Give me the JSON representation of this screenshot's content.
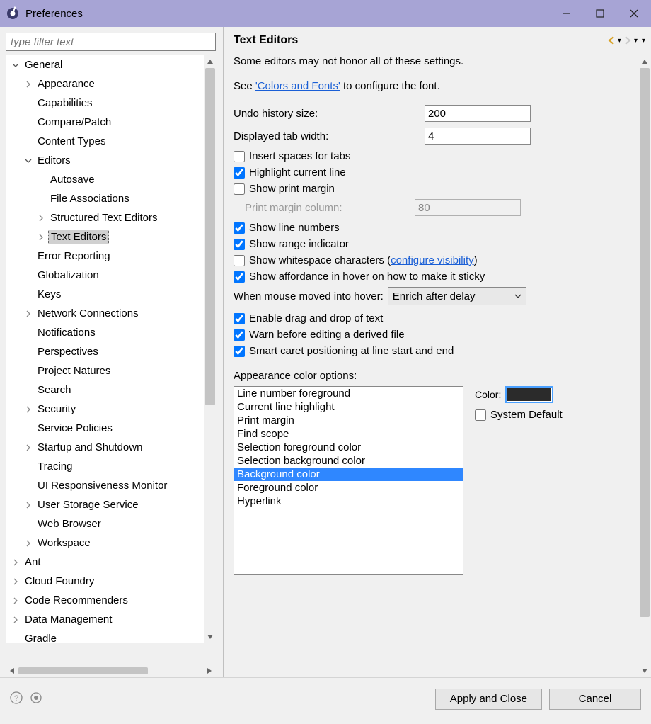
{
  "window": {
    "title": "Preferences"
  },
  "filter": {
    "placeholder": "type filter text"
  },
  "tree": {
    "general": "General",
    "appearance": "Appearance",
    "capabilities": "Capabilities",
    "compare_patch": "Compare/Patch",
    "content_types": "Content Types",
    "editors": "Editors",
    "autosave": "Autosave",
    "file_assoc": "File Associations",
    "structured_te": "Structured Text Editors",
    "text_editors": "Text Editors",
    "error_reporting": "Error Reporting",
    "globalization": "Globalization",
    "keys": "Keys",
    "network": "Network Connections",
    "notifications": "Notifications",
    "perspectives": "Perspectives",
    "project_natures": "Project Natures",
    "search": "Search",
    "security": "Security",
    "service_policies": "Service Policies",
    "startup": "Startup and Shutdown",
    "tracing": "Tracing",
    "ui_resp": "UI Responsiveness Monitor",
    "user_storage": "User Storage Service",
    "web_browser": "Web Browser",
    "workspace": "Workspace",
    "ant": "Ant",
    "cloud_foundry": "Cloud Foundry",
    "code_rec": "Code Recommenders",
    "data_mgmt": "Data Management",
    "gradle": "Gradle"
  },
  "page": {
    "title": "Text Editors",
    "info1": "Some editors may not honor all of these settings.",
    "info2a": "See ",
    "info2link": "'Colors and Fonts'",
    "info2b": " to configure the font.",
    "undo_label": "Undo history size:",
    "undo_value": "200",
    "tabw_label": "Displayed tab width:",
    "tabw_value": "4",
    "cb_insert_spaces": "Insert spaces for tabs",
    "cb_highlight": "Highlight current line",
    "cb_print_margin": "Show print margin",
    "pm_col_label": "Print margin column:",
    "pm_col_value": "80",
    "cb_line_numbers": "Show line numbers",
    "cb_range": "Show range indicator",
    "cb_whitespace_a": "Show whitespace characters (",
    "cb_whitespace_link": "configure visibility",
    "cb_whitespace_b": ")",
    "cb_affordance": "Show affordance in hover on how to make it sticky",
    "hover_label": "When mouse moved into hover:",
    "hover_value": "Enrich after delay",
    "cb_dnd": "Enable drag and drop of text",
    "cb_warn_derived": "Warn before editing a derived file",
    "cb_smart_caret": "Smart caret positioning at line start and end",
    "color_section": "Appearance color options:",
    "color_label": "Color:",
    "cb_sysdefault": "System Default",
    "color_items": {
      "0": "Line number foreground",
      "1": "Current line highlight",
      "2": "Print margin",
      "3": "Find scope",
      "4": "Selection foreground color",
      "5": "Selection background color",
      "6": "Background color",
      "7": "Foreground color",
      "8": "Hyperlink"
    }
  },
  "buttons": {
    "apply": "Apply and Close",
    "cancel": "Cancel"
  }
}
